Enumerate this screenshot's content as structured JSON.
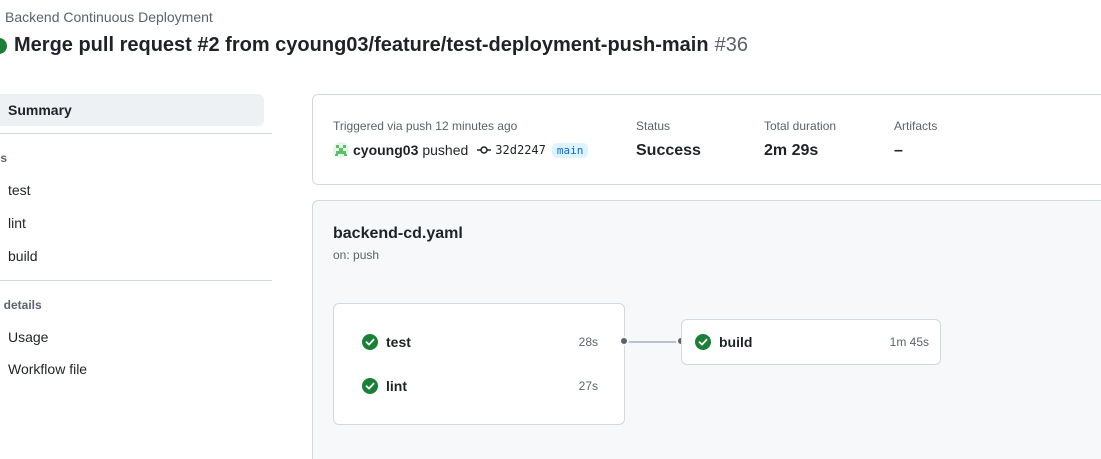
{
  "header": {
    "workflow_name": "Backend Continuous Deployment",
    "title": "Merge pull request #2 from cyoung03/feature/test-deployment-push-main",
    "run_number": "#36",
    "status_color": "#1a7f37"
  },
  "sidebar": {
    "summary_label": "Summary",
    "jobs_heading": "bs",
    "jobs": [
      {
        "label": "test"
      },
      {
        "label": "lint"
      },
      {
        "label": "build"
      }
    ],
    "run_details_heading": "n details",
    "run_details": [
      {
        "label": "Usage"
      },
      {
        "label": "Workflow file"
      }
    ]
  },
  "summary": {
    "trigger_label": "Triggered via push 12 minutes ago",
    "actor": "cyoung03",
    "action": "pushed",
    "commit": "32d2247",
    "branch": "main",
    "status_label": "Status",
    "status_value": "Success",
    "duration_label": "Total duration",
    "duration_value": "2m 29s",
    "artifacts_label": "Artifacts",
    "artifacts_value": "–"
  },
  "graph": {
    "file": "backend-cd.yaml",
    "trigger": "on: push",
    "jobs": [
      {
        "name": "test",
        "duration": "28s",
        "status": "success"
      },
      {
        "name": "lint",
        "duration": "27s",
        "status": "success"
      },
      {
        "name": "build",
        "duration": "1m 45s",
        "status": "success"
      }
    ]
  },
  "icons": {
    "status": "check-circle-fill-icon",
    "commit": "git-commit-icon",
    "avatar": "identicon-avatar"
  },
  "colors": {
    "success": "#1a7f37",
    "link": "#0969da",
    "branch_bg": "#ddf4ff"
  }
}
